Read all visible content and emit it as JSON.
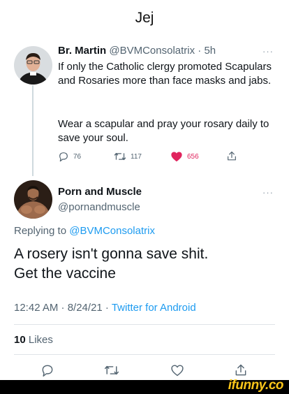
{
  "caption": "Jej",
  "parent_tweet": {
    "author_name": "Br. Martin",
    "author_handle": "@BVMConsolatrix",
    "time": "· 5h",
    "more": "···",
    "text_line1": "If only the Catholic clergy promoted Scapulars and Rosaries more than face masks and jabs.",
    "text_line2": "Wear a scapular and pray your rosary daily to save your soul.",
    "replies": "76",
    "retweets": "117",
    "likes": "656",
    "like_color": "#e0245e"
  },
  "reply_tweet": {
    "author_name": "Porn and Muscle",
    "author_handle": "@pornandmuscle",
    "more": "···",
    "replying_prefix": "Replying to",
    "replying_mention": "@BVMConsolatrix",
    "text_line1": "A rosery isn't gonna save shit.",
    "text_line2": "Get the vaccine",
    "timestamp": "12:42 AM · 8/24/21 · ",
    "source": "Twitter for Android",
    "likes_count": "10",
    "likes_label": "Likes"
  },
  "colors": {
    "link": "#1d9bf0",
    "muted": "#536471"
  },
  "watermark": "ifunny.co"
}
